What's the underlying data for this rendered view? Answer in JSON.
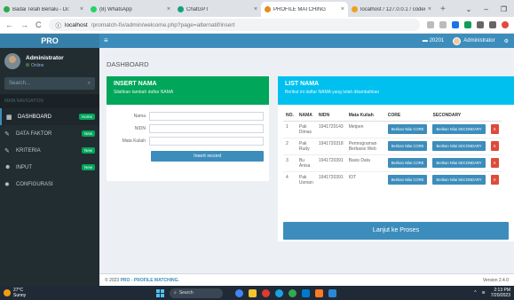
{
  "browser": {
    "tabs": [
      {
        "label": "Badai Telah Berlalu - Di:",
        "color": "#2eaa4a",
        "active": false
      },
      {
        "label": "(8) WhatsApp",
        "color": "#25d366",
        "active": false
      },
      {
        "label": "ChatGPT",
        "color": "#10a37f",
        "active": false
      },
      {
        "label": "PROFILE MATCHING",
        "color": "#e58b1c",
        "active": true
      },
      {
        "label": "localhost / 127.0.0.1 / coder",
        "color": "#f0a020",
        "active": false
      }
    ],
    "url_host": "localhost",
    "url_path": "/promatch-fix/admin/welcome.php?page=alternatif/insert"
  },
  "app": {
    "logo": "PRO",
    "nav_user_id": "20201",
    "nav_user_name": "Administrator"
  },
  "sidebar": {
    "user_name": "Administrator",
    "user_status": "Online",
    "search_placeholder": "Search...",
    "section_header": "MAIN NAVIGATION",
    "items": [
      {
        "icon": "dashboard-icon",
        "label": "DASHBOARD",
        "badge": "Home"
      },
      {
        "icon": "wrench-icon",
        "label": "DATA FAKTOR",
        "badge": "New"
      },
      {
        "icon": "wrench-icon",
        "label": "KRITERIA",
        "badge": "New"
      },
      {
        "icon": "users-icon",
        "label": "INPUT",
        "badge": "New"
      },
      {
        "icon": "gear-icon",
        "label": "CONFIGURASI",
        "badge": ""
      }
    ]
  },
  "content": {
    "title": "DASHBOARD",
    "insert": {
      "title": "INSERT NAMA",
      "subtitle": "Silahkan tambah daftar NAMA",
      "fields": [
        {
          "label": "Nama",
          "value": ""
        },
        {
          "label": "NIDN",
          "value": ""
        },
        {
          "label": "Mata Kuliah",
          "value": ""
        }
      ],
      "button": "Insert record"
    },
    "list": {
      "title": "LIST NAMA",
      "subtitle": "Berikut ini daftar NAMA yang telah ditambahkan",
      "headers": [
        "NO.",
        "NAMA",
        "NIDN",
        "Mata Kuliah",
        "CORE",
        "SECONDARY",
        ""
      ],
      "rows": [
        {
          "no": "1",
          "nama": "Pak Dimas",
          "nidn": "1941720143",
          "mk": "Metpen"
        },
        {
          "no": "2",
          "nama": "Pak Rudy",
          "nidn": "1941720318",
          "mk": "Pemrograman Berbasis Web"
        },
        {
          "no": "3",
          "nama": "Bu Anisa",
          "nidn": "1941720391",
          "mk": "Basis Data"
        },
        {
          "no": "4",
          "nama": "Pak Usman",
          "nidn": "1941720391",
          "mk": "IOT"
        }
      ],
      "core_button": "Berikan Nilai CORE",
      "secondary_button": "Berikan Nilai SECONDARY",
      "delete_button": "X",
      "proceed_button": "Lanjut ke Proses"
    }
  },
  "footer": {
    "copyright": "© 2023",
    "brand": "PRO - PROFILE MATCHING.",
    "version": "Version 2.4.0"
  },
  "taskbar": {
    "weather_temp": "27°C",
    "weather_text": "Sunny",
    "search": "Search",
    "time": "2:13 PM",
    "date": "7/20/2023"
  }
}
